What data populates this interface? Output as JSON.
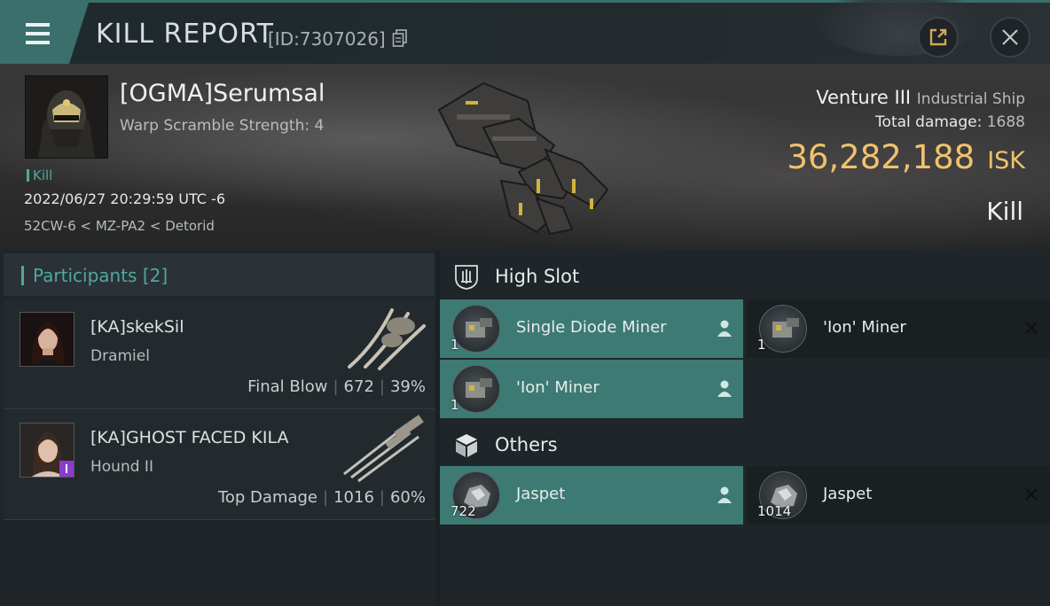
{
  "topbar": {
    "title": "KILL REPORT",
    "id_label": "[ID:7307026]",
    "icons": [
      "menu-icon",
      "copy-icon",
      "share-icon",
      "close-icon"
    ]
  },
  "victim": {
    "name": "[OGMA]Serumsal",
    "subtitle": "Warp Scramble Strength: 4",
    "tag": "Kill",
    "datetime": "2022/06/27 20:29:59 UTC -6",
    "location": "52CW-6 < MZ-PA2 < Detorid",
    "ship_name": "Venture III",
    "ship_class": "Industrial Ship",
    "total_damage_label": "Total damage:",
    "total_damage": "1688",
    "isk_amount": "36,282,188",
    "isk_unit": "ISK",
    "result": "Kill"
  },
  "participants": {
    "label": "Participants [2]",
    "rows": [
      {
        "name": "[KA]skekSil",
        "ship": "Dramiel",
        "role": "Final Blow",
        "damage": "672",
        "percent": "39%"
      },
      {
        "name": "[KA]GHOST FACED KILA",
        "ship": "Hound II",
        "role": "Top Damage",
        "damage": "1016",
        "percent": "60%"
      }
    ]
  },
  "sections": {
    "high_slot": {
      "label": "High Slot",
      "items": [
        {
          "name": "Single Diode Miner",
          "qty": "1",
          "state": "dropped"
        },
        {
          "name": "'Ion' Miner",
          "qty": "1",
          "state": "destroyed"
        },
        {
          "name": "'Ion' Miner",
          "qty": "1",
          "state": "dropped"
        }
      ]
    },
    "others": {
      "label": "Others",
      "items": [
        {
          "name": "Jaspet",
          "qty": "722",
          "state": "dropped"
        },
        {
          "name": "Jaspet",
          "qty": "1014",
          "state": "destroyed"
        }
      ]
    }
  },
  "colors": {
    "accent": "#3b6f6c",
    "dropped": "#3c7a73",
    "isk": "#f0c26e",
    "highlight_text": "#4fa89d"
  }
}
